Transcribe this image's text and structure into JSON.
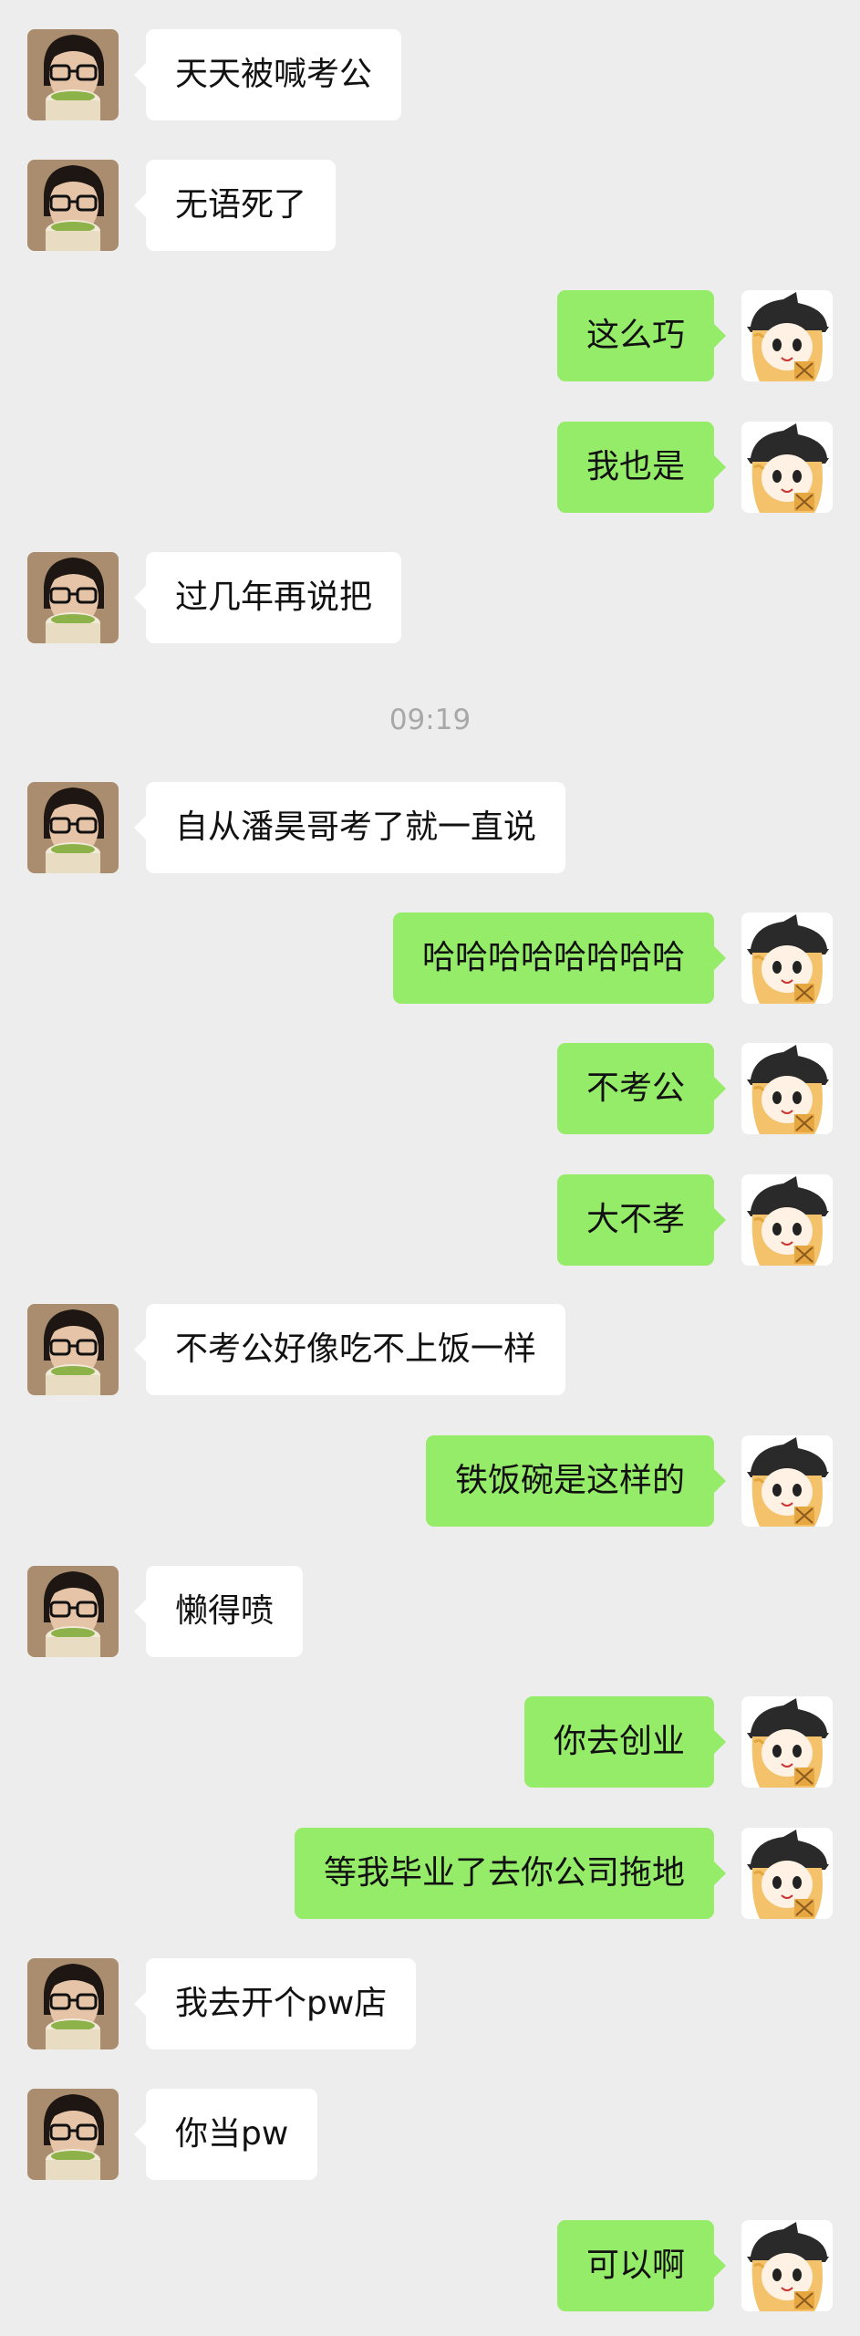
{
  "timestamp": "09:19",
  "messages": [
    {
      "side": "left",
      "text": "天天被喊考公"
    },
    {
      "side": "left",
      "text": "无语死了"
    },
    {
      "side": "right",
      "text": "这么巧"
    },
    {
      "side": "right",
      "text": "我也是"
    },
    {
      "side": "left",
      "text": "过几年再说把"
    },
    {
      "side": "left",
      "text": "自从潘昊哥考了就一直说"
    },
    {
      "side": "right",
      "text": "哈哈哈哈哈哈哈哈"
    },
    {
      "side": "right",
      "text": "不考公"
    },
    {
      "side": "right",
      "text": "大不孝"
    },
    {
      "side": "left",
      "text": "不考公好像吃不上饭一样"
    },
    {
      "side": "right",
      "text": "铁饭碗是这样的"
    },
    {
      "side": "left",
      "text": "懒得喷"
    },
    {
      "side": "right",
      "text": "你去创业"
    },
    {
      "side": "right",
      "text": "等我毕业了去你公司拖地"
    },
    {
      "side": "left",
      "text": "我去开个pw店"
    },
    {
      "side": "left",
      "text": "你当pw"
    },
    {
      "side": "right",
      "text": "可以啊"
    }
  ],
  "avatars": {
    "left": "user-photo-avatar",
    "right": "anime-witch-avatar"
  },
  "colors": {
    "background": "#ededed",
    "self_bubble": "#95ec69",
    "other_bubble": "#ffffff",
    "timestamp": "#a8a8a8"
  }
}
